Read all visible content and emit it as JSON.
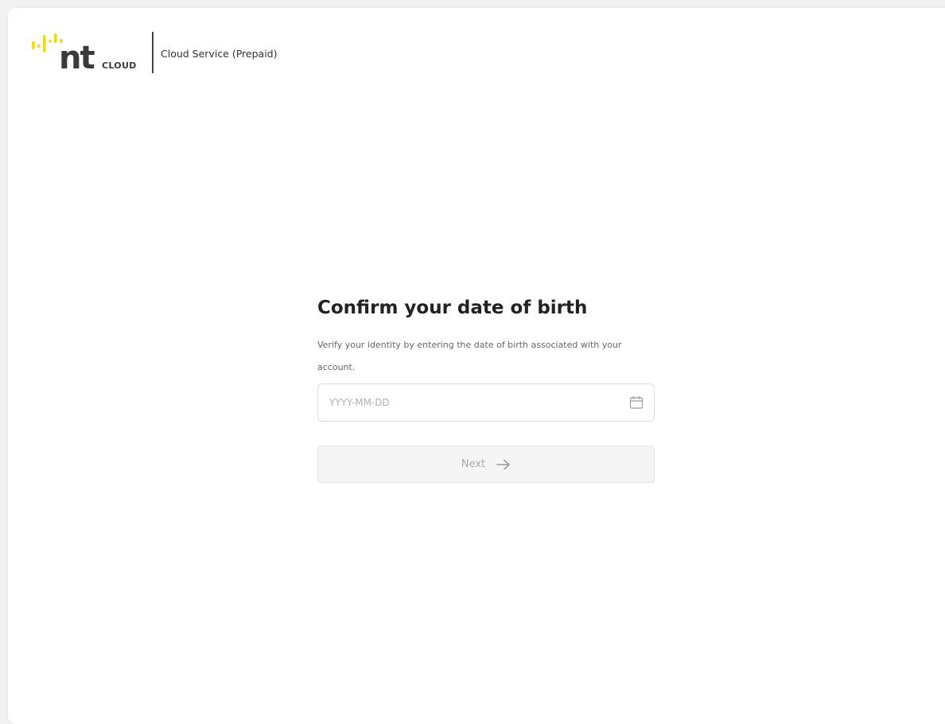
{
  "brand": {
    "logo_wordmark": "nt",
    "logo_subtext": "CLOUD",
    "service_name": "Cloud Service (Prepaid)",
    "accent_color": "#f5d90a",
    "text_color": "#3a3a3a"
  },
  "form": {
    "title": "Confirm your date of birth",
    "description": "Verify your identity by entering the date of birth associated with your account.",
    "dob_input": {
      "value": "",
      "placeholder": "YYYY-MM-DD",
      "icon": "calendar-icon"
    },
    "next_button": {
      "label": "Next",
      "icon": "arrow-right-icon",
      "state": "disabled"
    }
  }
}
